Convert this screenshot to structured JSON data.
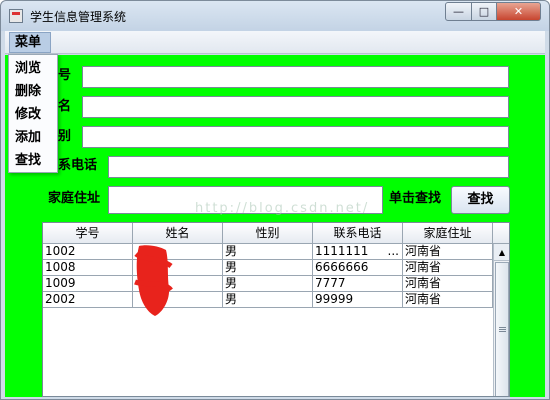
{
  "window": {
    "title": "学生信息管理系统"
  },
  "menu": {
    "title": "菜单",
    "items": [
      "浏览",
      "删除",
      "修改",
      "添加",
      "查找"
    ]
  },
  "form": {
    "student_id_label": "学号",
    "name_label": "姓名",
    "gender_label": "性别",
    "phone_label": "联系电话",
    "address_label": "家庭住址",
    "search_label": "单击查找",
    "search_button": "查找",
    "visible_label_fragments": {
      "student_id": "号",
      "name": "名",
      "gender": "别",
      "phone": "系电话"
    }
  },
  "table": {
    "headers": [
      "学号",
      "姓名",
      "性别",
      "联系电话",
      "家庭住址"
    ],
    "rows": [
      [
        "1002",
        "",
        "男",
        "1111111",
        "河南省"
      ],
      [
        "1008",
        "",
        "男",
        "6666666",
        "河南省"
      ],
      [
        "1009",
        "",
        "男",
        "7777",
        "河南省"
      ],
      [
        "2002",
        "",
        "男",
        "99999",
        "河南省"
      ]
    ],
    "phone_overflow_marker": "..."
  },
  "watermark": "http://blog.csdn.net/",
  "colors": {
    "background": "#00ff00",
    "redaction": "#e8231c"
  }
}
